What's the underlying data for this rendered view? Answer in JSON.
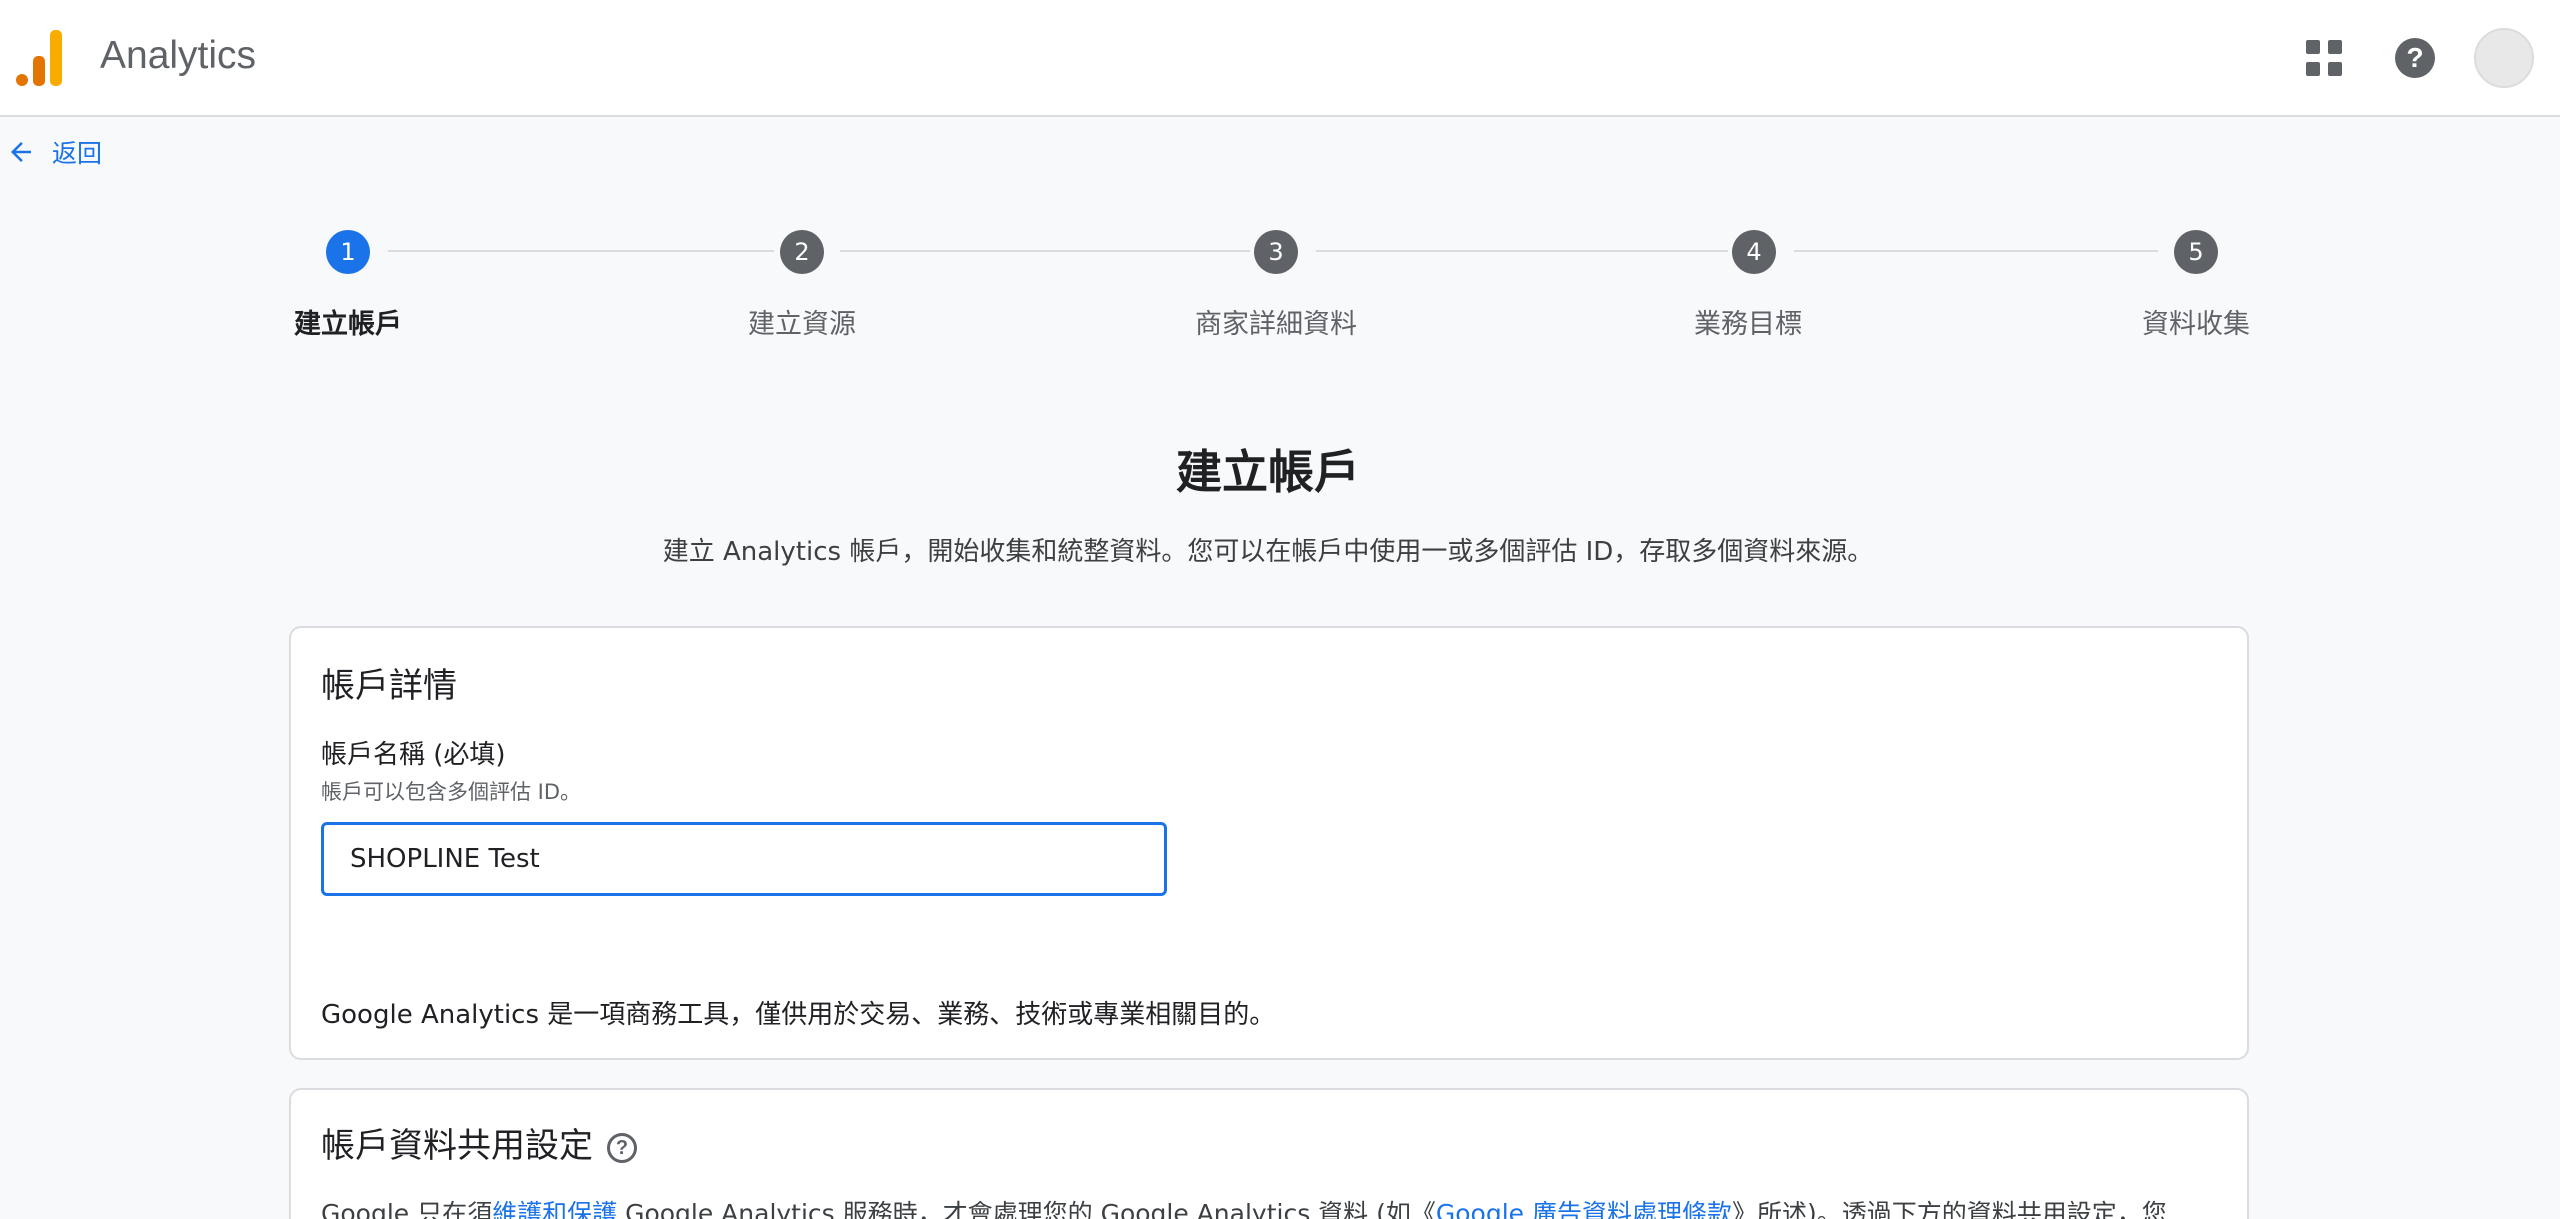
{
  "header": {
    "app_title": "Analytics"
  },
  "back": {
    "label": "返回"
  },
  "stepper": {
    "steps": [
      {
        "number": "1",
        "label": "建立帳戶"
      },
      {
        "number": "2",
        "label": "建立資源"
      },
      {
        "number": "3",
        "label": "商家詳細資料"
      },
      {
        "number": "4",
        "label": "業務目標"
      },
      {
        "number": "5",
        "label": "資料收集"
      }
    ],
    "active_step": 1
  },
  "page": {
    "title": "建立帳戶",
    "subtitle": "建立 Analytics 帳戶，開始收集和統整資料。您可以在帳戶中使用一或多個評估 ID，存取多個資料來源。"
  },
  "account_details": {
    "title": "帳戶詳情",
    "name_label": "帳戶名稱 (必填)",
    "name_hint": "帳戶可以包含多個評估 ID。",
    "name_value": "SHOPLINE Test",
    "disclaimer": "Google Analytics 是一項商務工具，僅供用於交易、業務、技術或專業相關目的。"
  },
  "data_sharing": {
    "title": "帳戶資料共用設定",
    "text_part1": "Google 只在須",
    "link1": "維護和保護",
    "text_part2": " Google Analytics 服務時，才會處理您的 Google Analytics 資料 (如《",
    "link2": "Google 廣告資料處理條款",
    "text_part3": "》所述)。透過下方的資料共用設定，您"
  },
  "colors": {
    "accent": "#1a73e8",
    "step_inactive": "#5f6368",
    "logo": [
      "#e37400",
      "#f9ab00"
    ]
  }
}
